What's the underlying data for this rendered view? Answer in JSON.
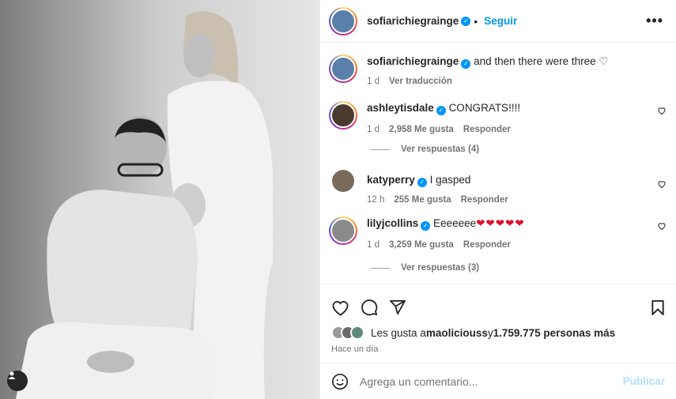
{
  "post": {
    "author": "sofiarichiegrainge",
    "follow_label": "Seguir",
    "more_label": "•••",
    "caption": "and then there were three ♡",
    "caption_time": "1 d",
    "translate_label": "Ver traducción"
  },
  "comments": [
    {
      "user": "ashleytisdale",
      "text": "CONGRATS!!!!",
      "time": "1 d",
      "likes": "2,958 Me gusta",
      "reply": "Responder",
      "view_replies": "Ver respuestas (4)"
    },
    {
      "user": "katyperry",
      "text": "I gasped",
      "time": "12 h",
      "likes": "255 Me gusta",
      "reply": "Responder",
      "view_replies": ""
    },
    {
      "user": "lilyjcollins",
      "text": "Eeeeeee",
      "hearts": "❤❤❤❤❤",
      "time": "1 d",
      "likes": "3,259 Me gusta",
      "reply": "Responder",
      "view_replies": "Ver respuestas (3)"
    }
  ],
  "likes": {
    "prefix": "Les gusta a ",
    "user": "maoliciouss",
    "middle": " y ",
    "count": "1.759.775 personas más"
  },
  "posted_time": "Hace un día",
  "add_comment": {
    "placeholder": "Agrega un comentario...",
    "publish_label": "Publicar"
  },
  "colors": {
    "accent": "#0095f6",
    "heart_red": "#e0102a",
    "muted": "#737373"
  }
}
